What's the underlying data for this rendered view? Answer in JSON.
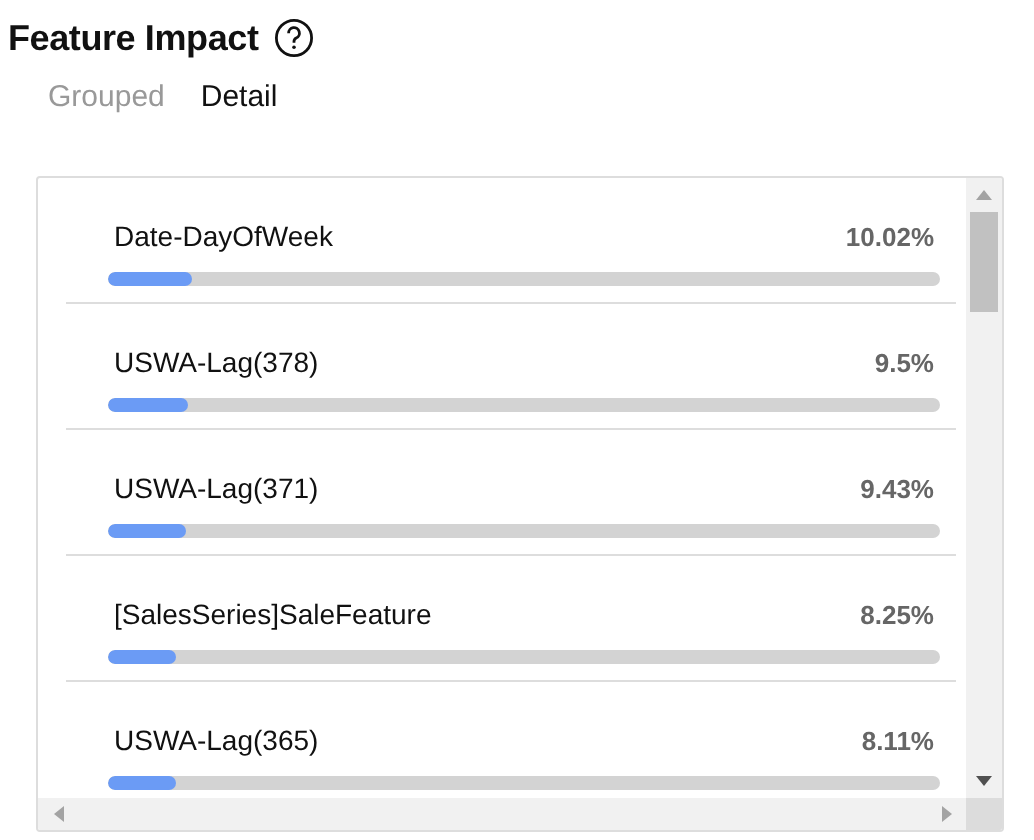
{
  "header": {
    "title": "Feature Impact"
  },
  "tabs": [
    {
      "label": "Grouped",
      "selected": false
    },
    {
      "label": "Detail",
      "selected": true
    }
  ],
  "features": [
    {
      "name": "Date-DayOfWeek",
      "value": "10.02%",
      "level": 0.1002
    },
    {
      "name": "USWA-Lag(378)",
      "value": "9.5%",
      "level": 0.095
    },
    {
      "name": "USWA-Lag(371)",
      "value": "9.43%",
      "level": 0.0943
    },
    {
      "name": "[SalesSeries]SaleFeature",
      "value": "8.25%",
      "level": 0.0825
    },
    {
      "name": "USWA-Lag(365)",
      "value": "8.11%",
      "level": 0.0811
    }
  ]
}
